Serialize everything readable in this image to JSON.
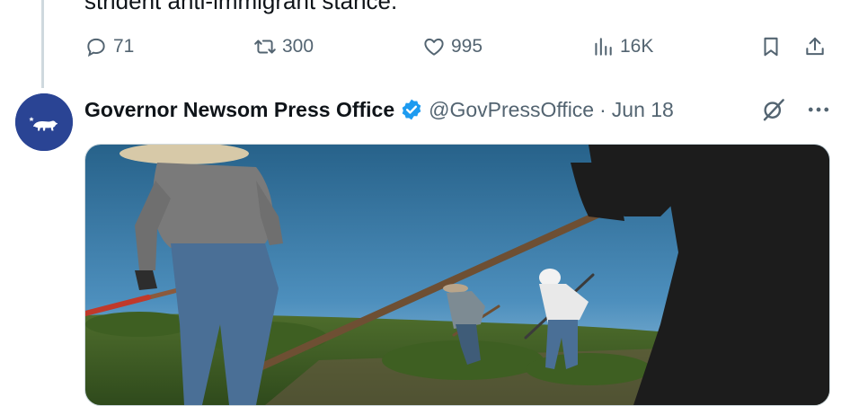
{
  "previous_tweet": {
    "text_fragment": "strident anti-immigrant stance."
  },
  "actions": {
    "reply_count": "71",
    "retweet_count": "300",
    "like_count": "995",
    "views_count": "16K"
  },
  "tweet": {
    "display_name": "Governor Newsom Press Office",
    "handle": "@GovPressOffice",
    "separator": "·",
    "date": "Jun 18"
  },
  "colors": {
    "verified_blue": "#1d9bf0",
    "muted_text": "#536471",
    "avatar_bg": "#2a4494"
  },
  "icons": [
    "reply-icon",
    "retweet-icon",
    "like-icon",
    "views-icon",
    "bookmark-icon",
    "share-icon",
    "verified-badge-icon",
    "grok-icon",
    "more-icon"
  ]
}
